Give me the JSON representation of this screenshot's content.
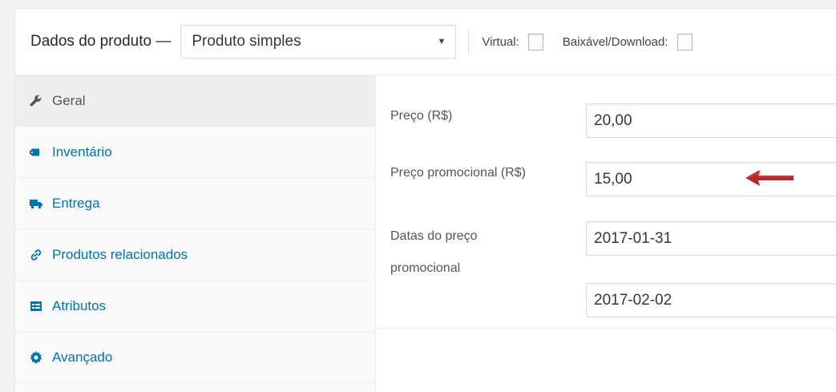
{
  "header": {
    "title": "Dados do produto —",
    "product_type": "Produto simples",
    "virtual_label": "Virtual:",
    "download_label": "Baixável/Download:"
  },
  "tabs": [
    {
      "label": "Geral",
      "icon": "wrench-icon",
      "active": true
    },
    {
      "label": "Inventário",
      "icon": "tag-icon",
      "active": false
    },
    {
      "label": "Entrega",
      "icon": "truck-icon",
      "active": false
    },
    {
      "label": "Produtos relacionados",
      "icon": "link-icon",
      "active": false
    },
    {
      "label": "Atributos",
      "icon": "list-icon",
      "active": false
    },
    {
      "label": "Avançado",
      "icon": "gear-icon",
      "active": false
    }
  ],
  "general": {
    "price_label": "Preço (R$)",
    "price_value": "20,00",
    "sale_price_label": "Preço promocional (R$)",
    "sale_price_value": "15,00",
    "sale_dates_label_line1": "Datas do preço",
    "sale_dates_label_line2": "promocional",
    "sale_date_from": "2017-01-31",
    "sale_date_to": "2017-02-02"
  },
  "colors": {
    "link": "#0073aa",
    "arrow": "#b01e1e"
  }
}
